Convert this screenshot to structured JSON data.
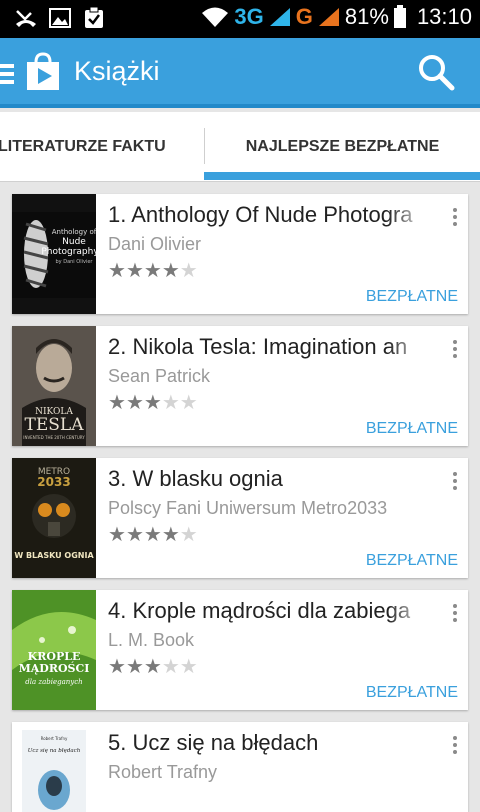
{
  "status_bar": {
    "network_3g": "3G",
    "network_g": "G",
    "battery": "81%",
    "time": "13:10"
  },
  "app_bar": {
    "title": "Książki"
  },
  "tabs": [
    {
      "label": "LITERATURZE FAKTU"
    },
    {
      "label": "NAJLEPSZE BEZPŁATNE"
    }
  ],
  "books": [
    {
      "title": "1. Anthology Of Nude Photogra",
      "author": "Dani Olivier",
      "rating": 4,
      "price": "BEZPŁATNE",
      "cover": {
        "line1": "Anthology of",
        "line2": "Nude",
        "line3": "Photography",
        "line4": "by Dani Olivier",
        "bg": "#111"
      }
    },
    {
      "title": "2. Nikola Tesla: Imagination an",
      "author": "Sean Patrick",
      "rating": 3,
      "price": "BEZPŁATNE",
      "cover": {
        "line1": "NIKOLA",
        "line2": "TESLA",
        "line3": "INVENTED THE 20TH CENTURY",
        "bg": "#4a4540"
      }
    },
    {
      "title": "3. W blasku ognia",
      "author": "Polscy Fani Uniwersum Metro2033",
      "rating": 4,
      "price": "BEZPŁATNE",
      "cover": {
        "line1": "METRO",
        "line2": "2033",
        "line3": "W BLASKU OGNIA",
        "bg": "#1c1a12"
      }
    },
    {
      "title": "4. Krople mądrości dla zabiega",
      "author": "L. M. Book",
      "rating": 3,
      "price": "BEZPŁATNE",
      "cover": {
        "line1": "KROPLE",
        "line2": "MĄDROŚCI",
        "line3": "dla zabieganych",
        "bg": "#5aa02c"
      }
    },
    {
      "title": "5. Ucz się na błędach",
      "author": "Robert Trafny",
      "rating": 0,
      "price": "",
      "cover": {
        "line1": "Robert Trafny",
        "line2": "Ucz się na błędach",
        "bg": "#e8eef2"
      }
    }
  ]
}
